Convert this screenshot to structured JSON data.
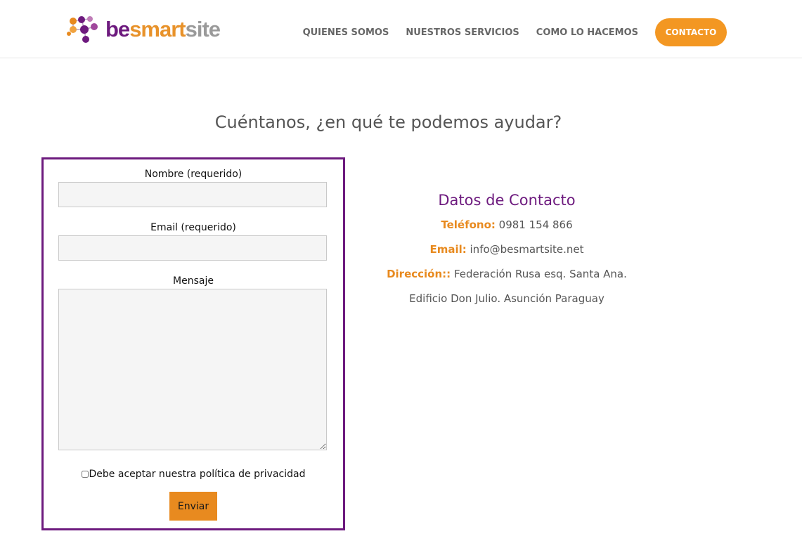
{
  "brand": {
    "logo_text": "besmartsite",
    "part_be": "be",
    "part_smart": "smart",
    "part_site": "site",
    "colors": {
      "purple": "#6d1a7e",
      "orange": "#e88a1f",
      "gray": "#9a9a9a"
    }
  },
  "nav": {
    "items": [
      {
        "label": "QUIENES SOMOS"
      },
      {
        "label": "NUESTROS SERVICIOS"
      },
      {
        "label": "COMO LO HACEMOS"
      }
    ],
    "cta_label": "CONTACTO"
  },
  "page": {
    "title": "Cuéntanos, ¿en qué te podemos ayudar?"
  },
  "form": {
    "name_label": "Nombre (requerido)",
    "name_value": "",
    "email_label": "Email (requerido)",
    "email_value": "",
    "message_label": "Mensaje",
    "message_value": "",
    "consent_label": "Debe aceptar nuestra política de privacidad",
    "submit_label": "Enviar"
  },
  "contact": {
    "title": "Datos de Contacto",
    "phone_key": "Teléfono:",
    "phone_value": "0981 154 866",
    "email_key": "Email:",
    "email_value": "info@besmartsite.net",
    "address_key": "Dirección::",
    "address_line1": "Federación Rusa esq. Santa Ana.",
    "address_line2": "Edificio Don Julio. Asunción Paraguay"
  }
}
